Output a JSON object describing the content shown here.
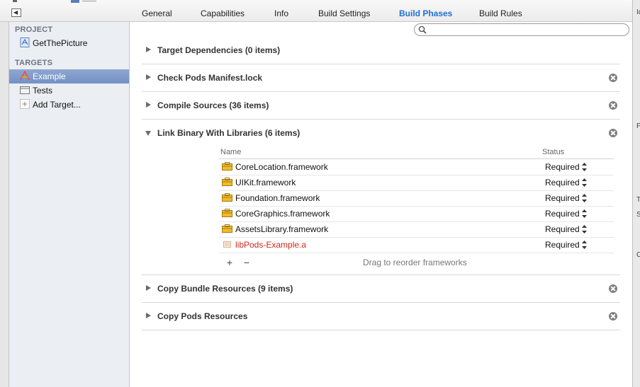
{
  "tabs": [
    {
      "label": "General"
    },
    {
      "label": "Capabilities"
    },
    {
      "label": "Info"
    },
    {
      "label": "Build Settings"
    },
    {
      "label": "Build Phases",
      "active": true
    },
    {
      "label": "Build Rules"
    }
  ],
  "sidebar": {
    "project_header": "PROJECT",
    "project_items": [
      {
        "label": "GetThePicture",
        "icon": "project-file-icon"
      }
    ],
    "targets_header": "TARGETS",
    "target_items": [
      {
        "label": "Example",
        "icon": "app-target-icon",
        "selected": true
      },
      {
        "label": "Tests",
        "icon": "test-bundle-icon"
      },
      {
        "label": "Add Target...",
        "icon": "add-target-icon"
      }
    ]
  },
  "search": {
    "value": "",
    "placeholder": ""
  },
  "phases": [
    {
      "title": "Target Dependencies (0 items)",
      "expanded": false,
      "deletable": false
    },
    {
      "title": "Check Pods Manifest.lock",
      "expanded": false,
      "deletable": true
    },
    {
      "title": "Compile Sources (36 items)",
      "expanded": false,
      "deletable": true
    },
    {
      "title": "Link Binary With Libraries (6 items)",
      "expanded": true,
      "deletable": true
    },
    {
      "title": "Copy Bundle Resources (9 items)",
      "expanded": false,
      "deletable": true
    },
    {
      "title": "Copy Pods Resources",
      "expanded": false,
      "deletable": true
    }
  ],
  "libraries": {
    "columns": {
      "name": "Name",
      "status": "Status"
    },
    "rows": [
      {
        "name": "CoreLocation.framework",
        "status": "Required",
        "icon": "framework-icon"
      },
      {
        "name": "UIKit.framework",
        "status": "Required",
        "icon": "framework-icon"
      },
      {
        "name": "Foundation.framework",
        "status": "Required",
        "icon": "framework-icon"
      },
      {
        "name": "CoreGraphics.framework",
        "status": "Required",
        "icon": "framework-icon"
      },
      {
        "name": "AssetsLibrary.framework",
        "status": "Required",
        "icon": "framework-icon"
      },
      {
        "name": "libPods-Example.a",
        "status": "Required",
        "icon": "static-library-icon",
        "missing": true
      }
    ],
    "add_label": "+",
    "remove_label": "−",
    "drag_hint": "Drag to reorder frameworks"
  },
  "inspector_fragments": [
    "Id",
    "P",
    "T",
    "S",
    "C"
  ],
  "colors": {
    "active_tab": "#1f70d3",
    "selection": "#7391c6",
    "missing_file": "#d0271c",
    "framework_icon": "#e8b219"
  }
}
